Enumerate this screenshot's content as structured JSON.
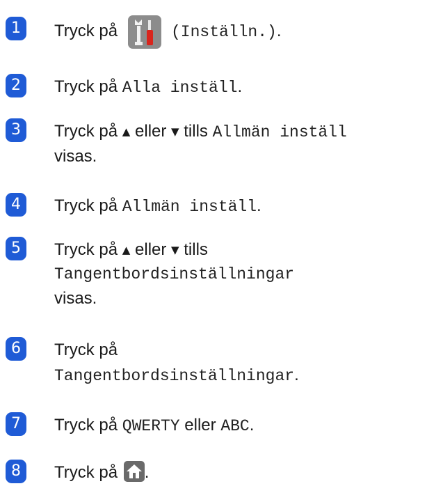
{
  "steps": [
    {
      "number": "1",
      "text": "Tryck på",
      "mono": "(Inställn.)",
      "end": "."
    },
    {
      "number": "2",
      "text": "Tryck på",
      "mono": "Alla inställ",
      "end": "."
    },
    {
      "number": "3",
      "text1": "Tryck på",
      "up": "▲",
      "or": "eller",
      "down": "▼",
      "until": "tills",
      "mono": "Allmän inställ",
      "line2": "visas."
    },
    {
      "number": "4",
      "text": "Tryck på",
      "mono": "Allmän inställ",
      "end": "."
    },
    {
      "number": "5",
      "text1": "Tryck på",
      "up": "▲",
      "or": "eller",
      "down": "▼",
      "until": "tills",
      "mono": "Tangentbordsinställningar",
      "line3": "visas."
    },
    {
      "number": "6",
      "text": "Tryck på",
      "mono": "Tangentbordsinställningar",
      "end": "."
    },
    {
      "number": "7",
      "text": "Tryck på",
      "mono1": "QWERTY",
      "or": "eller",
      "mono2": "ABC",
      "end": "."
    },
    {
      "number": "8",
      "text": "Tryck på",
      "end": "."
    }
  ],
  "icons": {
    "settings": "tools-icon",
    "home": "home-icon"
  },
  "colors": {
    "badge": "#1f5bd6",
    "settings_icon_bg": "#8c8c8c",
    "home_icon_bg": "#6a6a6a"
  }
}
